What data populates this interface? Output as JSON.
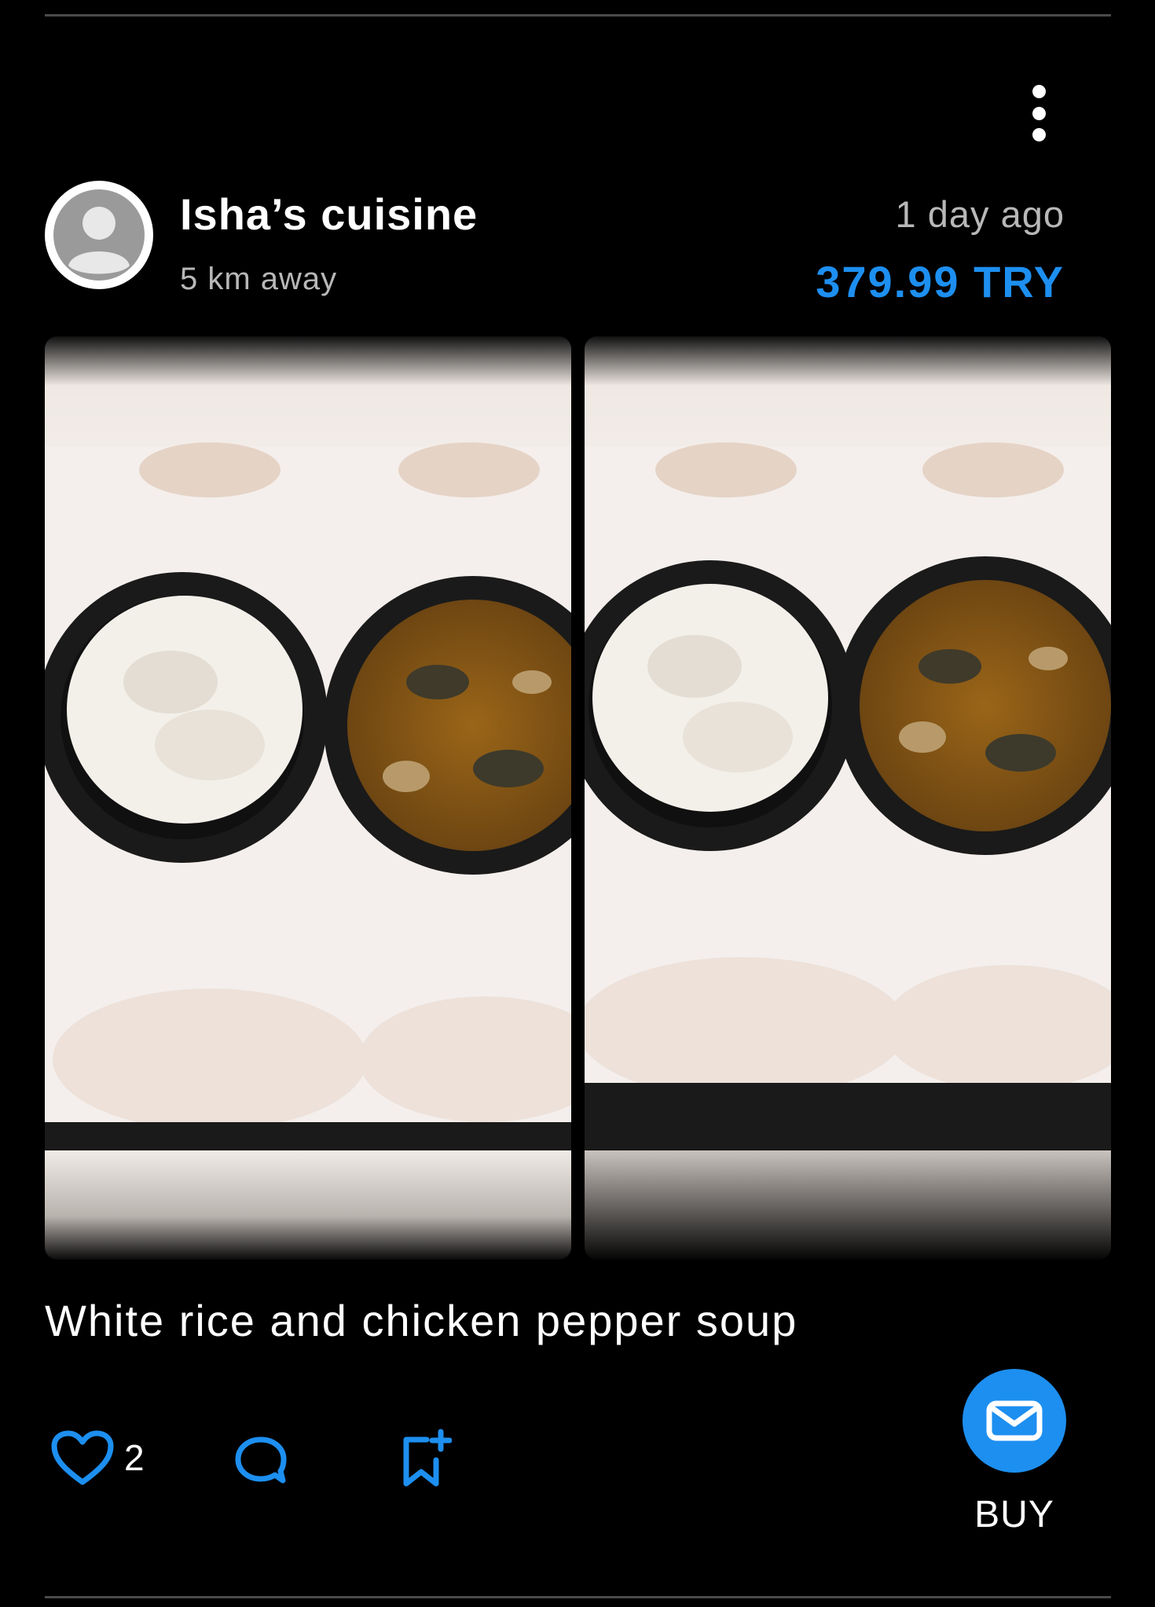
{
  "post": {
    "seller_name": "Isha’s cuisine",
    "distance": "5 km away",
    "time": "1 day ago",
    "price": "379.99 TRY",
    "caption": "White rice and chicken pepper soup",
    "like_count": "2",
    "buy_label": "BUY"
  },
  "icons": {
    "menu": "more-vertical-icon",
    "avatar": "user-placeholder-icon",
    "like": "heart-outline-icon",
    "comment": "comment-bubble-icon",
    "save": "bookmark-add-icon",
    "buy": "mail-envelope-icon"
  },
  "colors": {
    "background": "#000000",
    "accent": "#1d8ff0",
    "secondary_text": "#b8b8b8",
    "divider": "#4a4a4a"
  }
}
